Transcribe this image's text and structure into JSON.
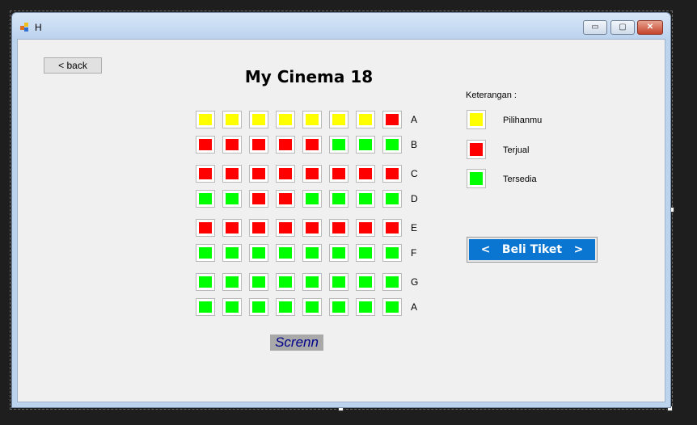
{
  "window": {
    "title": "H"
  },
  "titlebar_buttons": {
    "minimize": "▭",
    "maximize": "▢",
    "close": "✕"
  },
  "back_button": "< back",
  "title": "My Cinema 18",
  "colors": {
    "selected": "#ffff00",
    "sold": "#ff0000",
    "available": "#00ff00"
  },
  "rows": [
    {
      "label": "A",
      "seats": [
        "selected",
        "selected",
        "selected",
        "selected",
        "selected",
        "selected",
        "selected",
        "sold"
      ]
    },
    {
      "label": "B",
      "seats": [
        "sold",
        "sold",
        "sold",
        "sold",
        "sold",
        "available",
        "available",
        "available"
      ]
    },
    {
      "label": "C",
      "seats": [
        "sold",
        "sold",
        "sold",
        "sold",
        "sold",
        "sold",
        "sold",
        "sold"
      ]
    },
    {
      "label": "D",
      "seats": [
        "available",
        "available",
        "sold",
        "sold",
        "available",
        "available",
        "available",
        "available"
      ]
    },
    {
      "label": "E",
      "seats": [
        "sold",
        "sold",
        "sold",
        "sold",
        "sold",
        "sold",
        "sold",
        "sold"
      ]
    },
    {
      "label": "F",
      "seats": [
        "available",
        "available",
        "available",
        "available",
        "available",
        "available",
        "available",
        "available"
      ]
    },
    {
      "label": "G",
      "seats": [
        "available",
        "available",
        "available",
        "available",
        "available",
        "available",
        "available",
        "available"
      ]
    },
    {
      "label": "A",
      "seats": [
        "available",
        "available",
        "available",
        "available",
        "available",
        "available",
        "available",
        "available"
      ]
    }
  ],
  "screen_label": "Screnn",
  "legend": {
    "title": "Keterangan :",
    "items": [
      {
        "status": "selected",
        "label": "Pilihanmu"
      },
      {
        "status": "sold",
        "label": "Terjual"
      },
      {
        "status": "available",
        "label": "Tersedia"
      }
    ]
  },
  "buy_button": "<   Beli Tiket   >"
}
